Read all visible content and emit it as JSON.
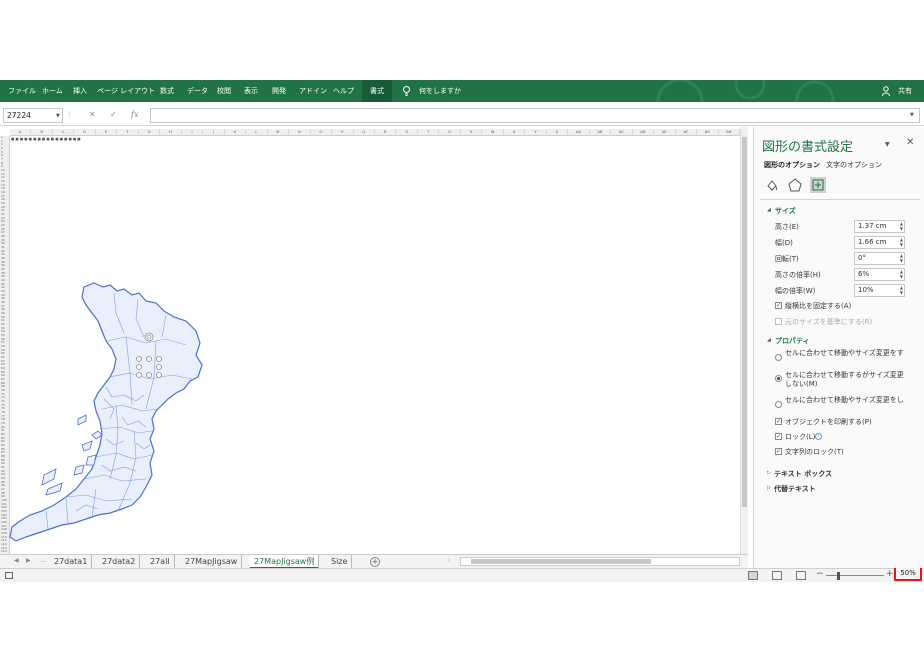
{
  "ribbon": {
    "tabs": [
      "ファイル",
      "ホーム",
      "挿入",
      "ページ レイアウト",
      "数式",
      "データ",
      "校閲",
      "表示",
      "開発",
      "アドイン",
      "ヘルプ",
      "書式"
    ],
    "active_tab": "書式",
    "tell_me": "何をしますか",
    "share": "共有",
    "color": "#217346"
  },
  "formula_bar": {
    "name_box": "27224",
    "cancel_symbol": "✕",
    "enter_symbol": "✓",
    "fx_symbol": "fx",
    "value": ""
  },
  "sheet": {
    "columns": [
      "A",
      "B",
      "C",
      "D",
      "E",
      "F",
      "G",
      "H",
      "I",
      "J",
      "K",
      "L",
      "M",
      "N",
      "O",
      "P",
      "Q",
      "R",
      "S",
      "T",
      "U",
      "V",
      "W",
      "X",
      "Y",
      "Z",
      "AA",
      "AB",
      "AC",
      "AD",
      "AE",
      "AF",
      "AG",
      "AH"
    ],
    "rows": [
      "1",
      "2",
      "3",
      "4",
      "5",
      "6",
      "7",
      "8",
      "9",
      "10",
      "11",
      "12",
      "13",
      "14",
      "15",
      "16",
      "17",
      "18",
      "19",
      "20",
      "21",
      "22",
      "23",
      "24",
      "25",
      "26",
      "27",
      "28",
      "29",
      "30",
      "31",
      "32",
      "33",
      "34",
      "35",
      "36",
      "37",
      "38",
      "39",
      "40",
      "41",
      "42",
      "43",
      "44",
      "45",
      "46",
      "47",
      "48",
      "49",
      "50",
      "51",
      "52",
      "53",
      "54",
      "55",
      "56",
      "57",
      "58",
      "59",
      "60",
      "61",
      "62",
      "63",
      "64",
      "65",
      "66",
      "67",
      "68",
      "69",
      "70",
      "71",
      "72",
      "73",
      "74",
      "75",
      "76",
      "77",
      "78",
      "79",
      "80",
      "81",
      "82",
      "83",
      "84",
      "85",
      "86",
      "87",
      "88",
      "89",
      "90",
      "91",
      "92",
      "93",
      "94",
      "95",
      "96",
      "97",
      "98",
      "99",
      "100",
      "101",
      "102",
      "103",
      "104",
      "105",
      "106",
      "107",
      "108",
      "109",
      "110",
      "111",
      "112",
      "113",
      "114"
    ],
    "map_fill": "#e9f0fb",
    "map_stroke": "#4a6fd6"
  },
  "sheet_tabs": {
    "tabs": [
      "27data1",
      "27data2",
      "27all",
      "27MapJigsaw",
      "27MapJigsaw例",
      "Size"
    ],
    "active": "27MapJigsaw例",
    "add_symbol": "+"
  },
  "status_bar": {
    "zoom_level": "50%",
    "zoom_minus": "−",
    "zoom_plus": "+",
    "highlight_color": "#e81123"
  },
  "pane": {
    "title": "図形の書式設定",
    "close": "✕",
    "tabs": [
      "図形のオプション",
      "文字のオプション"
    ],
    "icon_names": [
      "fill-line-icon",
      "effects-icon",
      "size-properties-icon"
    ],
    "size_section": {
      "heading": "サイズ",
      "fields": [
        {
          "label": "高さ(E)",
          "value": "1.37 cm"
        },
        {
          "label": "幅(D)",
          "value": "1.66 cm"
        },
        {
          "label": "回転(T)",
          "value": "0°"
        },
        {
          "label": "高さの倍率(H)",
          "value": "6%"
        },
        {
          "label": "幅の倍率(W)",
          "value": "10%"
        }
      ],
      "lock_aspect": "縦横比を固定する(A)",
      "relative_original": "元のサイズを基準にする(R)"
    },
    "properties_section": {
      "heading": "プロパティ",
      "radios": [
        "セルに合わせて移動やサイズ変更をする(S)",
        "セルに合わせて移動するがサイズ変更しない(M)",
        "セルに合わせて移動やサイズ変更をしない(D)"
      ],
      "selected_radio": 1,
      "checkboxes": [
        {
          "label": "オブジェクトを印刷する(P)",
          "checked": true
        },
        {
          "label": "ロック(L)",
          "checked": true
        },
        {
          "label": "文字列のロック(T)",
          "checked": true
        }
      ]
    },
    "textbox_section": "テキスト ボックス",
    "alt_text_section": "代替テキスト"
  }
}
